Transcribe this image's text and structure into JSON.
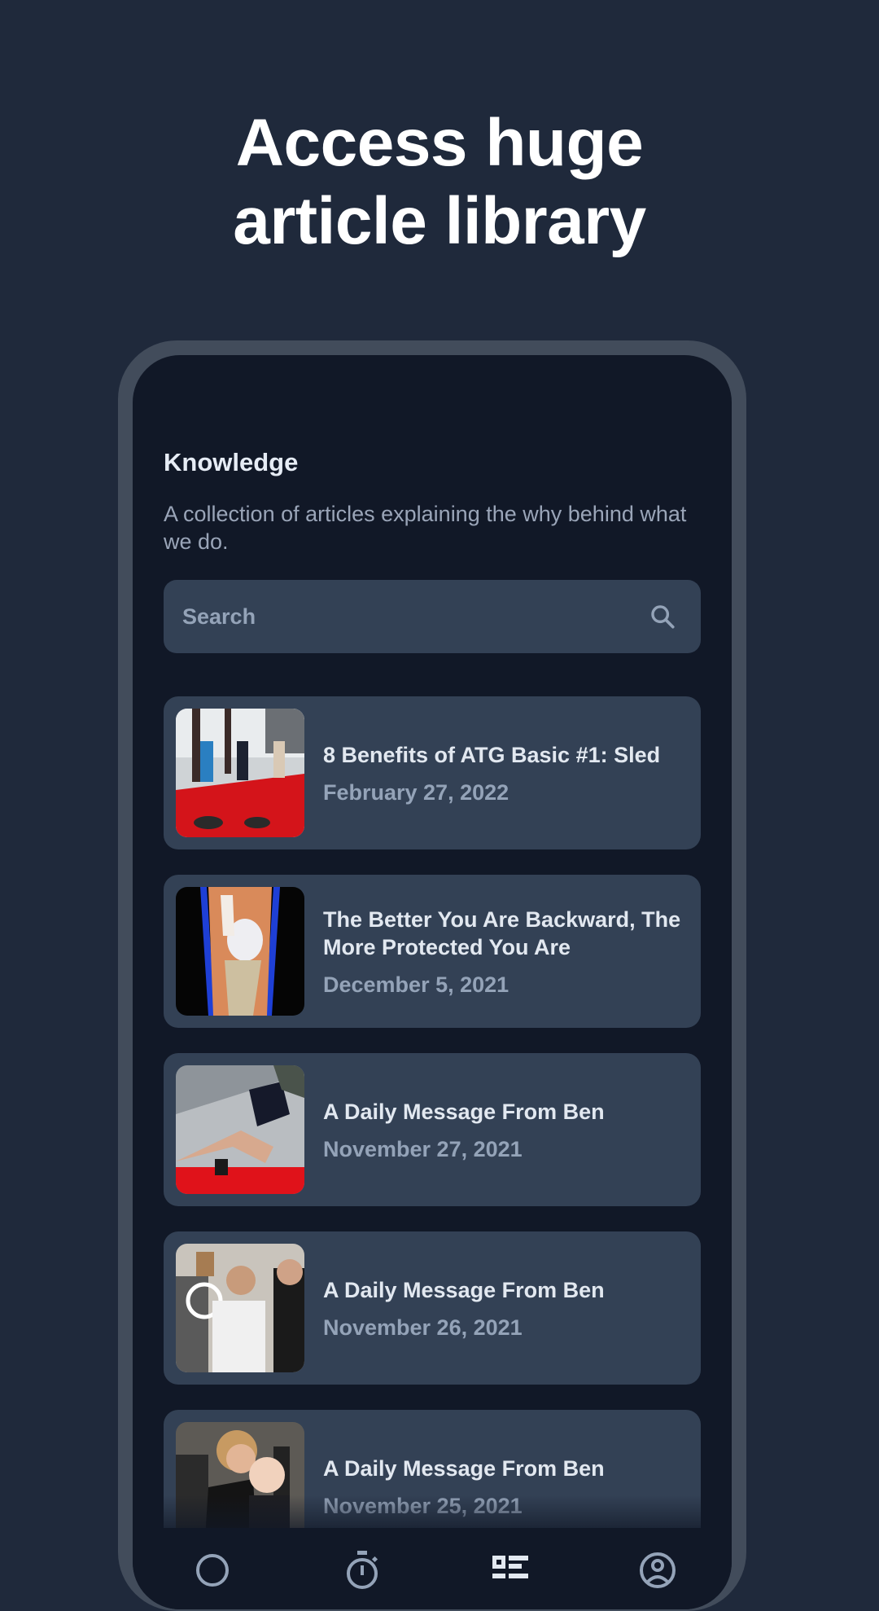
{
  "headline": {
    "line1": "Access huge",
    "line2": "article library"
  },
  "screen": {
    "title": "Knowledge",
    "subtitle": "A collection of articles explaining the why behind what we do.",
    "search": {
      "placeholder": "Search",
      "icon": "search-icon"
    },
    "articles": [
      {
        "title": "8 Benefits of ATG Basic #1: Sled",
        "date": "February 27, 2022",
        "image": "sled-training-photo"
      },
      {
        "title": "The Better You Are Backward, The More Protected You Are",
        "date": "December 5, 2021",
        "image": "knee-anatomy-illustration"
      },
      {
        "title": "A Daily Message From Ben",
        "date": "November 27, 2021",
        "image": "lunge-exercise-photo"
      },
      {
        "title": "A Daily Message From Ben",
        "date": "November 26, 2021",
        "image": "coach-talking-photo"
      },
      {
        "title": "A Daily Message From Ben",
        "date": "November 25, 2021",
        "image": "mother-and-child-photo"
      }
    ],
    "nav": [
      {
        "name": "search",
        "icon": "search-circle-icon",
        "active": false
      },
      {
        "name": "timer",
        "icon": "stopwatch-icon",
        "active": false
      },
      {
        "name": "articles",
        "icon": "article-list-icon",
        "active": true
      },
      {
        "name": "profile",
        "icon": "profile-icon",
        "active": false
      }
    ]
  },
  "colors": {
    "background": "#1f293b",
    "phone_frame": "#424c5b",
    "screen_bg": "#111827",
    "card_bg": "#334155",
    "title_text": "#e2e8f0",
    "muted_text": "#94a3b8"
  }
}
